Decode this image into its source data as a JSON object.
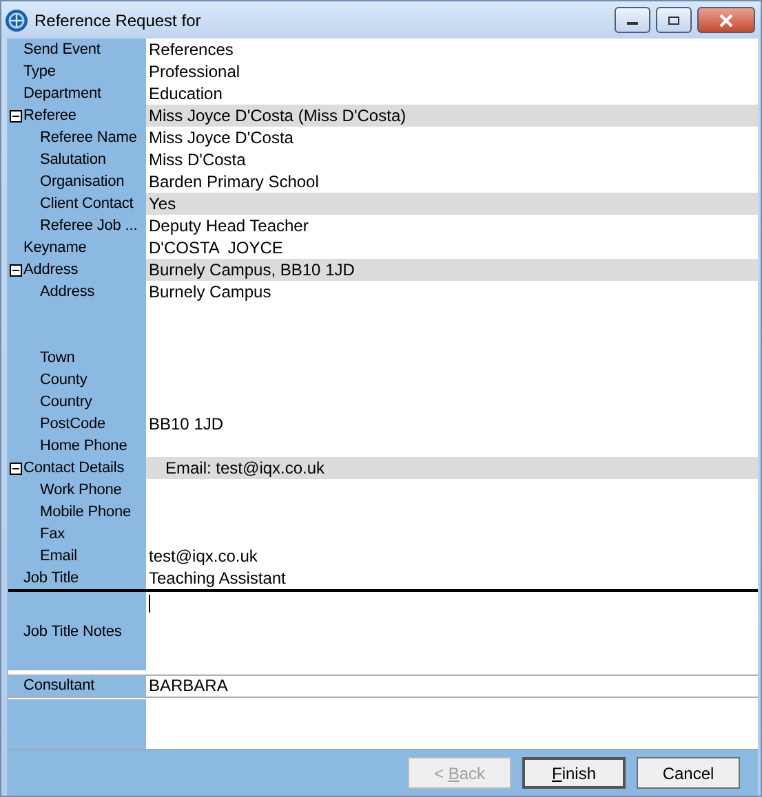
{
  "window": {
    "title": "Reference Request for"
  },
  "properties": [
    {
      "label": "Send Event",
      "value": "References",
      "highlighted": false
    },
    {
      "label": "Type",
      "value": "Professional",
      "highlighted": false
    },
    {
      "label": "Department",
      "value": "Education",
      "highlighted": false
    },
    {
      "label": "Referee",
      "value": "Miss Joyce D'Costa (Miss D'Costa)",
      "highlighted": true,
      "expanded": true,
      "children": [
        {
          "label": "Referee Name",
          "value": "Miss Joyce D'Costa",
          "highlighted": false
        },
        {
          "label": "Salutation",
          "value": "Miss D'Costa",
          "highlighted": false
        },
        {
          "label": "Organisation",
          "value": "Barden Primary School",
          "highlighted": false
        },
        {
          "label": "Client Contact",
          "value": "Yes",
          "highlighted": true
        },
        {
          "label": "Referee Job ...",
          "value": "Deputy Head Teacher",
          "highlighted": false
        }
      ]
    },
    {
      "label": "Keyname",
      "value": "D'COSTA  JOYCE",
      "highlighted": false
    },
    {
      "label": "Address",
      "value": "Burnely Campus, BB10 1JD",
      "highlighted": true,
      "expanded": true,
      "children": [
        {
          "label": "Address",
          "value": "Burnely Campus",
          "highlighted": false,
          "kind": "multiline"
        },
        {
          "label": "Town",
          "highlighted": false
        },
        {
          "label": "County",
          "highlighted": false
        },
        {
          "label": "Country",
          "highlighted": false
        },
        {
          "label": "PostCode",
          "value": "BB10 1JD",
          "highlighted": false
        },
        {
          "label": "Home Phone",
          "highlighted": false
        }
      ]
    },
    {
      "label": "Contact Details",
      "value": "Email: test@iqx.co.uk",
      "highlighted": true,
      "expanded": true,
      "children": [
        {
          "label": "Work Phone",
          "highlighted": false
        },
        {
          "label": "Mobile Phone",
          "highlighted": false
        },
        {
          "label": "Fax",
          "highlighted": false
        },
        {
          "label": "Email",
          "value": "test@iqx.co.uk",
          "highlighted": false
        }
      ]
    },
    {
      "label": "Job Title",
      "value": "Teaching Assistant",
      "highlighted": false
    }
  ],
  "notes": {
    "label": "Job Title Notes",
    "focused": true
  },
  "consultant": {
    "label": "Consultant",
    "value": "BARBARA"
  },
  "buttons": [
    {
      "label_before_key": "< ",
      "access_key": "B",
      "label_after_key": "ack",
      "disabled": true,
      "default": false
    },
    {
      "access_key": "F",
      "label_after_key": "inish",
      "disabled": false,
      "default": true
    },
    {
      "label": "Cancel",
      "disabled": false,
      "default": false
    }
  ]
}
